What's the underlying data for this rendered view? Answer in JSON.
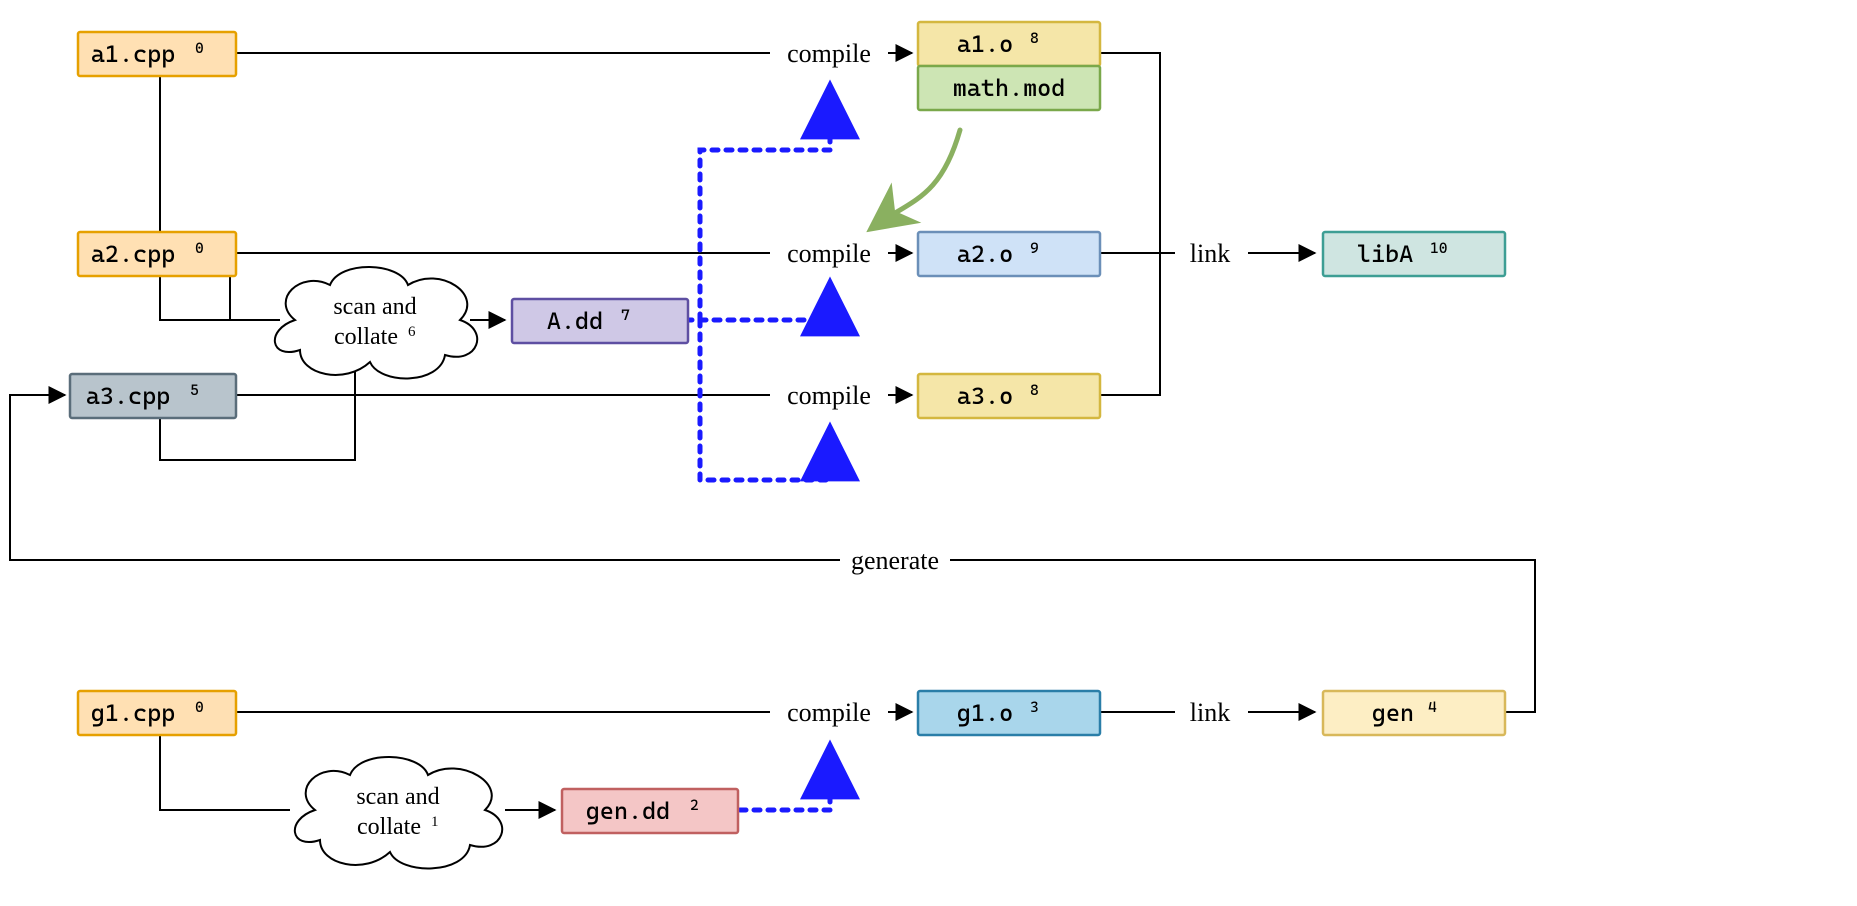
{
  "nodes": {
    "a1_cpp": {
      "label": "a1.cpp",
      "sup": "0"
    },
    "a2_cpp": {
      "label": "a2.cpp",
      "sup": "0"
    },
    "a3_cpp": {
      "label": "a3.cpp",
      "sup": "5"
    },
    "g1_cpp": {
      "label": "g1.cpp",
      "sup": "0"
    },
    "scan1": {
      "label_line1": "scan and",
      "label_line2": "collate",
      "sup": "6"
    },
    "scan2": {
      "label_line1": "scan and",
      "label_line2": "collate",
      "sup": "1"
    },
    "A_dd": {
      "label": "A.dd",
      "sup": "7"
    },
    "gen_dd": {
      "label": "gen.dd",
      "sup": "2"
    },
    "a1_o": {
      "label": "a1.o",
      "sup": "8"
    },
    "math_mod": {
      "label": "math.mod"
    },
    "a2_o": {
      "label": "a2.o",
      "sup": "9"
    },
    "a3_o": {
      "label": "a3.o",
      "sup": "8"
    },
    "g1_o": {
      "label": "g1.o",
      "sup": "3"
    },
    "libA": {
      "label": "libA",
      "sup": "10"
    },
    "gen": {
      "label": "gen",
      "sup": "4"
    }
  },
  "edge_labels": {
    "compile": "compile",
    "link": "link",
    "generate": "generate"
  },
  "colors": {
    "orange_fill": "#ffe0b3",
    "orange_stroke": "#e6a000",
    "slate_fill": "#b8c4cc",
    "slate_stroke": "#5a6d7a",
    "cloud_fill": "#ffffff",
    "cloud_stroke": "#000000",
    "violet_fill": "#cfc8e6",
    "violet_stroke": "#5e4fa2",
    "pink_fill": "#f4c6c6",
    "pink_stroke": "#c06060",
    "yellow_fill": "#f5e6a8",
    "yellow_stroke": "#d4b73f",
    "green_fill": "#cde5b4",
    "green_stroke": "#7aa84a",
    "lblue_fill": "#cfe2f7",
    "lblue_stroke": "#6b8fb8",
    "cyan_fill": "#cfe5e1",
    "cyan_stroke": "#3d9e94",
    "blue_fill": "#a9d6eb",
    "blue_stroke": "#2a7ea8",
    "cream_fill": "#fdeec4",
    "cream_stroke": "#d8b85a",
    "arrow_black": "#000000",
    "arrow_blue": "#1a1aff",
    "arrow_green": "#8ab060"
  }
}
